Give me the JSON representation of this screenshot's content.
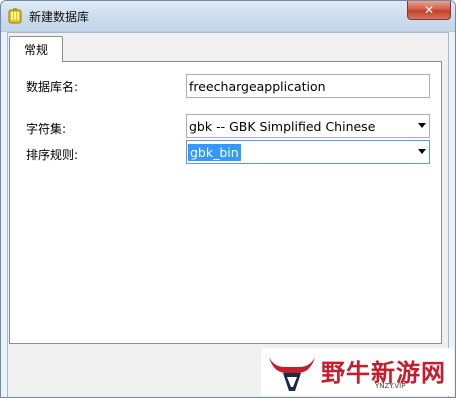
{
  "window": {
    "title": "新建数据库",
    "close_glyph": "✕"
  },
  "tabs": [
    {
      "label": "常规",
      "active": true
    }
  ],
  "form": {
    "db_name": {
      "label": "数据库名:",
      "value": "freechargeapplication"
    },
    "charset": {
      "label": "字符集:",
      "value": "gbk -- GBK Simplified Chinese"
    },
    "collation": {
      "label": "排序规则:",
      "value": "gbk_bin"
    }
  },
  "watermark": {
    "text": "野牛新游网",
    "subtext": "YNZY.VIP",
    "accent_color": "#c41d2c"
  },
  "icons": {
    "app": "database-icon",
    "close": "close-icon",
    "dropdown": "chevron-down-icon",
    "logo": "bull-logo-icon"
  }
}
